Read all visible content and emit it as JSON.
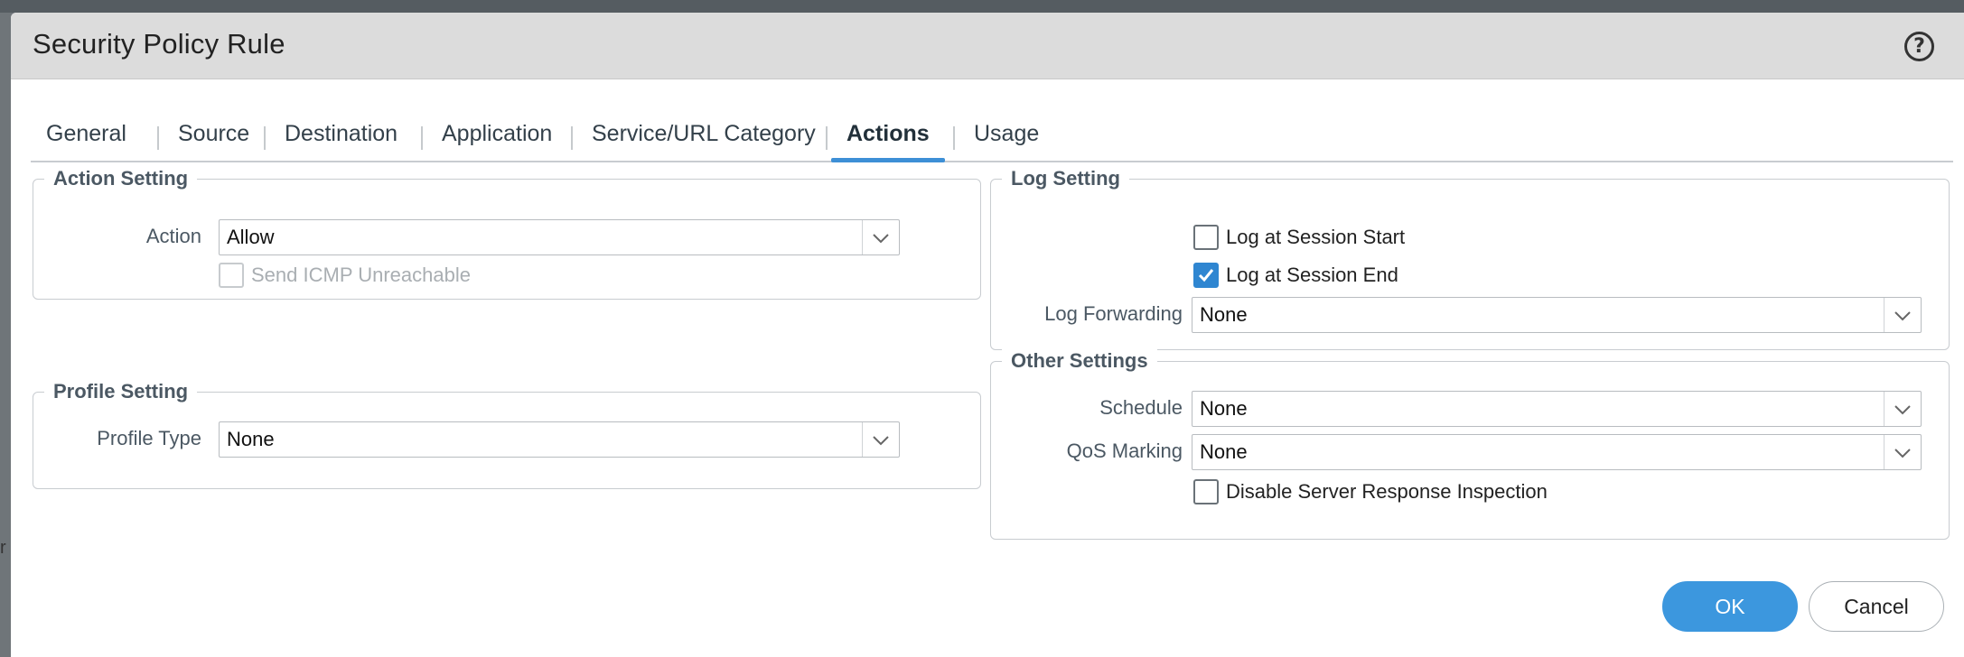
{
  "dialog": {
    "title": "Security Policy Rule",
    "help_symbol": "?"
  },
  "tabs": [
    {
      "label": "General"
    },
    {
      "label": "Source"
    },
    {
      "label": "Destination"
    },
    {
      "label": "Application"
    },
    {
      "label": "Service/URL Category"
    },
    {
      "label": "Actions",
      "active": true
    },
    {
      "label": "Usage"
    }
  ],
  "action_setting": {
    "legend": "Action Setting",
    "action_label": "Action",
    "action_value": "Allow",
    "send_icmp_label": "Send ICMP Unreachable",
    "send_icmp_checked": false,
    "send_icmp_disabled": true
  },
  "profile_setting": {
    "legend": "Profile Setting",
    "profile_type_label": "Profile Type",
    "profile_type_value": "None"
  },
  "log_setting": {
    "legend": "Log Setting",
    "log_start_label": "Log at Session Start",
    "log_start_checked": false,
    "log_end_label": "Log at Session End",
    "log_end_checked": true,
    "log_forwarding_label": "Log Forwarding",
    "log_forwarding_value": "None"
  },
  "other_settings": {
    "legend": "Other Settings",
    "schedule_label": "Schedule",
    "schedule_value": "None",
    "qos_label": "QoS Marking",
    "qos_value": "None",
    "disable_srv_label": "Disable Server Response Inspection",
    "disable_srv_checked": false
  },
  "buttons": {
    "ok": "OK",
    "cancel": "Cancel"
  },
  "background": {
    "fragment_text": "r"
  },
  "colors": {
    "accent": "#3c97de",
    "title_bar": "#dcdcdc"
  }
}
